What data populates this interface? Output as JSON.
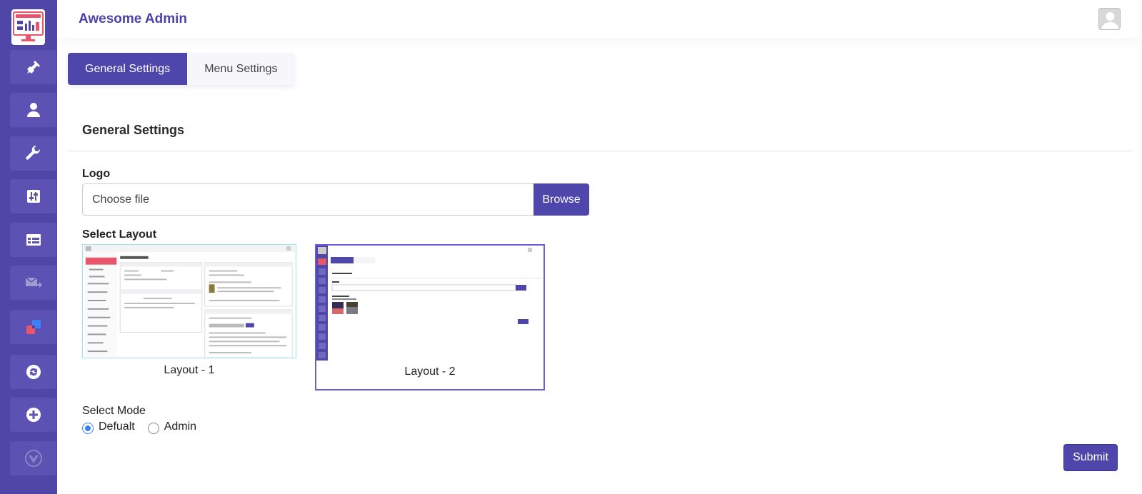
{
  "header": {
    "brand": "Awesome Admin"
  },
  "tabs": [
    {
      "label": "General Settings",
      "active": true
    },
    {
      "label": "Menu Settings",
      "active": false
    }
  ],
  "section_title": "General Settings",
  "logo": {
    "label": "Logo",
    "placeholder": "Choose file",
    "browse_label": "Browse"
  },
  "layout": {
    "label": "Select Layout",
    "options": [
      {
        "label": "Layout - 1",
        "selected": false
      },
      {
        "label": "Layout - 2",
        "selected": true
      }
    ]
  },
  "mode": {
    "label": "Select Mode",
    "options": [
      {
        "label": "Defualt",
        "checked": true
      },
      {
        "label": "Admin",
        "checked": false
      }
    ]
  },
  "submit_label": "Submit",
  "sidebar": {
    "icons": [
      "plug-icon",
      "user-icon",
      "wrench-icon",
      "sliders-icon",
      "table-icon",
      "mail-forward-icon",
      "puzzle-icon",
      "sync-icon",
      "plus-circle-icon",
      "vuejs-icon"
    ]
  },
  "colors": {
    "primary": "#4e46ab",
    "sidebar": "#5046a8",
    "radio": "#3b82f6",
    "accent": "#e9566b"
  }
}
